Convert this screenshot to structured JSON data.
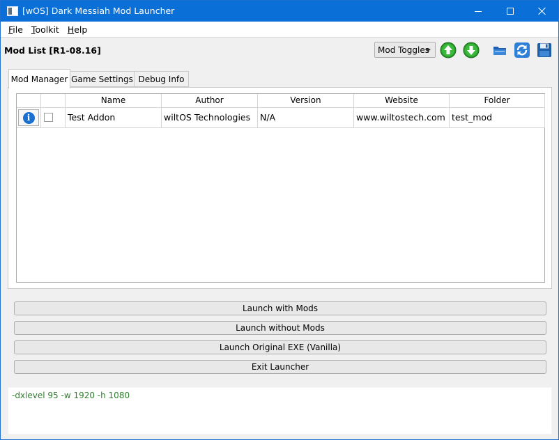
{
  "window": {
    "title": "[wOS] Dark Messiah Mod Launcher"
  },
  "menu": {
    "items": [
      {
        "first": "F",
        "rest": "ile"
      },
      {
        "first": "T",
        "rest": "oolkit"
      },
      {
        "first": "H",
        "rest": "elp"
      }
    ]
  },
  "toolbar": {
    "title": "Mod List [R1-08.16]",
    "combo_value": "Mod Toggles",
    "icons": [
      "arrow-up-icon",
      "arrow-down-icon",
      "folder-icon",
      "refresh-icon",
      "save-icon"
    ]
  },
  "tabs": [
    {
      "label": "Mod Manager",
      "active": true
    },
    {
      "label": "Game Settings",
      "active": false
    },
    {
      "label": "Debug Info",
      "active": false
    }
  ],
  "table": {
    "columns": [
      "",
      "",
      "Name",
      "Author",
      "Version",
      "Website",
      "Folder"
    ],
    "rows": [
      {
        "info_glyph": "i",
        "checked": false,
        "name": "Test Addon",
        "author": "wiltOS Technologies",
        "version": "N/A",
        "website": "www.wiltostech.com",
        "folder": "test_mod"
      }
    ]
  },
  "buttons": {
    "launch_mods": "Launch with Mods",
    "launch_no_mods": "Launch without Mods",
    "launch_vanilla": "Launch Original EXE (Vanilla)",
    "exit": "Exit Launcher"
  },
  "console": {
    "text": "-dxlevel 95 -w 1920 -h 1080"
  },
  "colors": {
    "titlebar": "#0a6fd6",
    "console_text": "#2e7d2e",
    "arrow_green": "#2a9a2a",
    "info_blue": "#1a6fd0"
  }
}
